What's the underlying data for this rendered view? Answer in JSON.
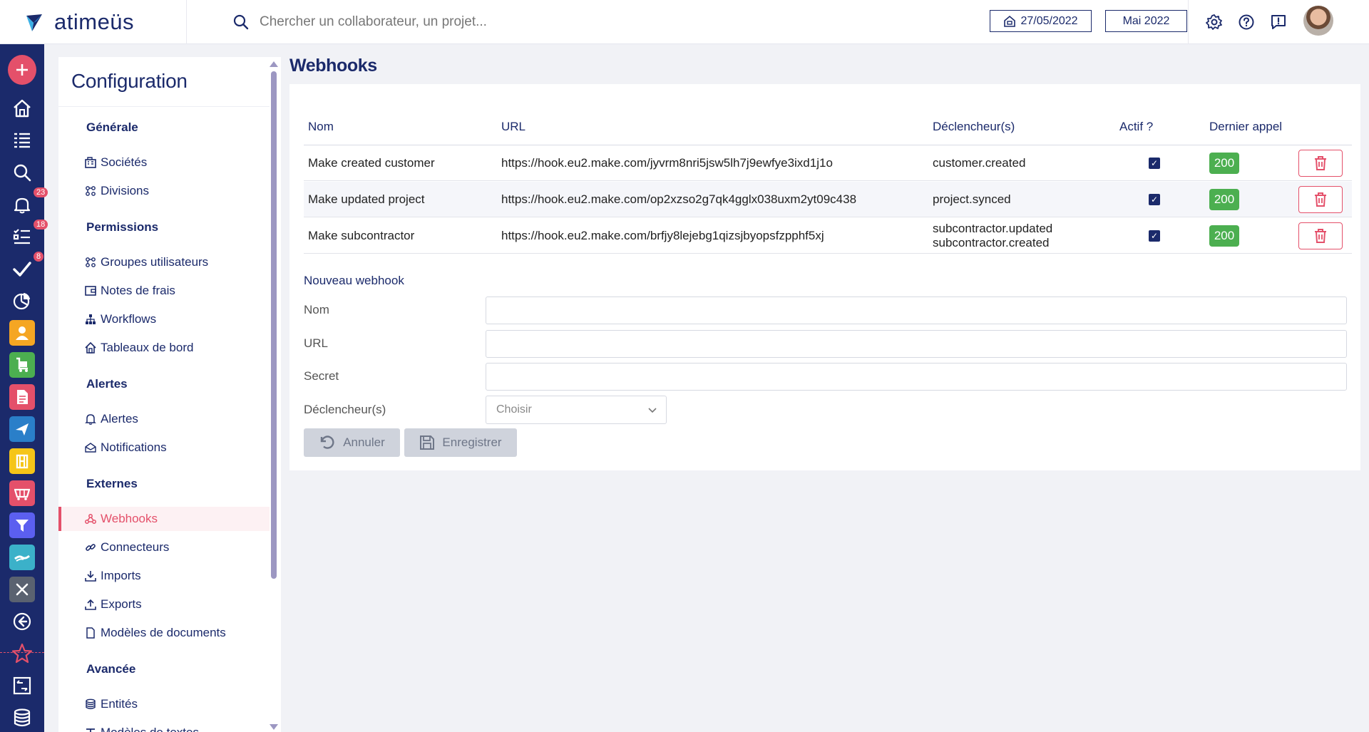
{
  "app": {
    "name": "atimeüs"
  },
  "search": {
    "placeholder": "Chercher un collaborateur, un projet..."
  },
  "header": {
    "date_button": "27/05/2022",
    "month_button": "Mai 2022",
    "icons": [
      "gear-icon",
      "help-icon",
      "feedback-icon"
    ]
  },
  "leftbar": {
    "badges": {
      "notifications": "23",
      "tasks": "18",
      "validations": "8"
    }
  },
  "config": {
    "title": "Configuration",
    "sections": {
      "generale": "Générale",
      "permissions": "Permissions",
      "alertes": "Alertes",
      "externes": "Externes",
      "avancee": "Avancée"
    },
    "items": {
      "societes": "Sociétés",
      "divisions": "Divisions",
      "groupes": "Groupes utilisateurs",
      "notes": "Notes de frais",
      "workflows": "Workflows",
      "tableaux": "Tableaux de bord",
      "alertes": "Alertes",
      "notifications": "Notifications",
      "webhooks": "Webhooks",
      "connecteurs": "Connecteurs",
      "imports": "Imports",
      "exports": "Exports",
      "modeles_docs": "Modèles de documents",
      "entites": "Entités",
      "modeles_textes": "Modèles de textes"
    },
    "active_item": "Webhooks"
  },
  "main": {
    "title": "Webhooks",
    "table": {
      "headers": {
        "nom": "Nom",
        "url": "URL",
        "declencheurs": "Déclencheur(s)",
        "actif": "Actif ?",
        "dernier_appel": "Dernier appel"
      },
      "rows": [
        {
          "nom": "Make created customer",
          "url": "https://hook.eu2.make.com/jyvrm8nri5jsw5lh7j9ewfye3ixd1j1o",
          "trigger1": "customer.created",
          "trigger2": "",
          "actif": true,
          "status": "200"
        },
        {
          "nom": "Make updated project",
          "url": "https://hook.eu2.make.com/op2xzso2g7qk4gglx038uxm2yt09c438",
          "trigger1": "project.synced",
          "trigger2": "",
          "actif": true,
          "status": "200"
        },
        {
          "nom": "Make subcontractor",
          "url": "https://hook.eu2.make.com/brfjy8lejebg1qizsjbyopsfzpphf5xj",
          "trigger1": "subcontractor.updated",
          "trigger2": "subcontractor.created",
          "actif": true,
          "status": "200"
        }
      ]
    },
    "form": {
      "title": "Nouveau webhook",
      "nom_label": "Nom",
      "url_label": "URL",
      "secret_label": "Secret",
      "trigger_label": "Déclencheur(s)",
      "trigger_placeholder": "Choisir",
      "cancel": "Annuler",
      "save": "Enregistrer"
    }
  },
  "colors": {
    "navy": "#1b2a6b",
    "accent": "#e4506a",
    "success": "#4caf50"
  }
}
